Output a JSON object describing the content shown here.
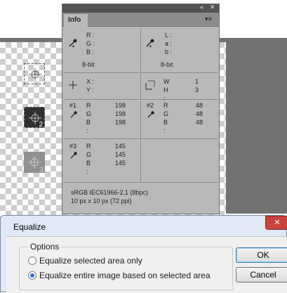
{
  "info_panel": {
    "collapse_glyph": "«",
    "close_glyph": "✕",
    "tab_label": "Info",
    "menu_glyph": "▾≡",
    "rgb_section": {
      "labels": [
        "R :",
        "G :",
        "B :"
      ],
      "bit_depth": "8-bit"
    },
    "lab_section": {
      "labels": [
        "L :",
        "a :",
        "b :"
      ],
      "bit_depth": "8-bit"
    },
    "xy_section": {
      "labels": [
        "X :",
        "Y :"
      ]
    },
    "wh_section": {
      "labels": [
        "W :",
        "H :"
      ],
      "values": [
        "1",
        "3"
      ]
    },
    "samplers": [
      {
        "id": "#1",
        "labels": [
          "R :",
          "G :",
          "B :"
        ],
        "values": [
          "198",
          "198",
          "198"
        ]
      },
      {
        "id": "#2",
        "labels": [
          "R :",
          "G :",
          "B :"
        ],
        "values": [
          "48",
          "48",
          "48"
        ]
      },
      {
        "id": "#3",
        "labels": [
          "R :",
          "G :",
          "B :"
        ],
        "values": [
          "145",
          "145",
          "145"
        ]
      }
    ],
    "footer": {
      "color_profile": "sRGB IEC61966-2.1 (8bpc)",
      "doc_size": "10 px x 10 px (72 ppi)"
    }
  },
  "canvas_samples": {
    "sample_1_color": "#c6c6c6",
    "sample_2_color": "#303030",
    "sample_3_color": "#919191",
    "sample_2_label": "2",
    "sample_3_label": "3"
  },
  "dialog": {
    "title": "Equalize",
    "close_glyph": "✕",
    "group_label": "Options",
    "options": [
      {
        "label": "Equalize selected area only",
        "checked": false
      },
      {
        "label": "Equalize entire image based on selected area",
        "checked": true
      }
    ],
    "ok_label": "OK",
    "cancel_label": "Cancel"
  }
}
